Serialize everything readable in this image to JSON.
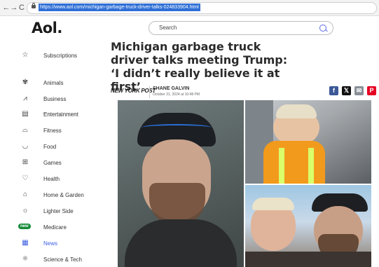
{
  "browser": {
    "back_glyph": "←",
    "forward_glyph": "→",
    "reload_glyph": "C",
    "url": "https://www.aol.com/michigan-garbage-truck-driver-talks-024833904.html"
  },
  "header": {
    "logo": "Aol.",
    "search_placeholder": "Search"
  },
  "sidebar": {
    "items": [
      {
        "label": "Subscriptions",
        "icon": "star-icon",
        "glyph": "☆"
      },
      {
        "label": "Animals",
        "icon": "paw-icon",
        "glyph": "✾"
      },
      {
        "label": "Business",
        "icon": "chart-icon",
        "glyph": "⩘"
      },
      {
        "label": "Entertainment",
        "icon": "clapper-icon",
        "glyph": "▤"
      },
      {
        "label": "Fitness",
        "icon": "shoe-icon",
        "glyph": "⌓"
      },
      {
        "label": "Food",
        "icon": "bowl-icon",
        "glyph": "◡"
      },
      {
        "label": "Games",
        "icon": "gamepad-icon",
        "glyph": "⊞"
      },
      {
        "label": "Health",
        "icon": "heart-icon",
        "glyph": "♡"
      },
      {
        "label": "Home & Garden",
        "icon": "house-icon",
        "glyph": "⌂"
      },
      {
        "label": "Lighter Side",
        "icon": "sun-icon",
        "glyph": "☼"
      },
      {
        "label": "Medicare",
        "icon": "new-badge",
        "badge": "new"
      },
      {
        "label": "News",
        "icon": "news-icon",
        "glyph": "▦"
      },
      {
        "label": "Science & Tech",
        "icon": "atom-icon",
        "glyph": "⚛"
      }
    ]
  },
  "article": {
    "headline": "Michigan garbage truck driver talks meeting Trump: ‘I didn’t really believe it at first’",
    "publisher": "NEW YORK POST",
    "author": "SHANE GALVIN",
    "date": "October 31, 2024 at 10:48 PM"
  },
  "share": [
    {
      "name": "facebook-share-button",
      "glyph": "f",
      "color": "#3b5998"
    },
    {
      "name": "x-share-button",
      "glyph": "𝕏",
      "color": "#111111"
    },
    {
      "name": "email-share-button",
      "glyph": "✉",
      "color": "#8a8f98"
    },
    {
      "name": "pinterest-share-button",
      "glyph": "P",
      "color": "#e60023"
    }
  ],
  "colors": {
    "accent": "#3a5ce0",
    "new_badge": "#168a3a"
  }
}
